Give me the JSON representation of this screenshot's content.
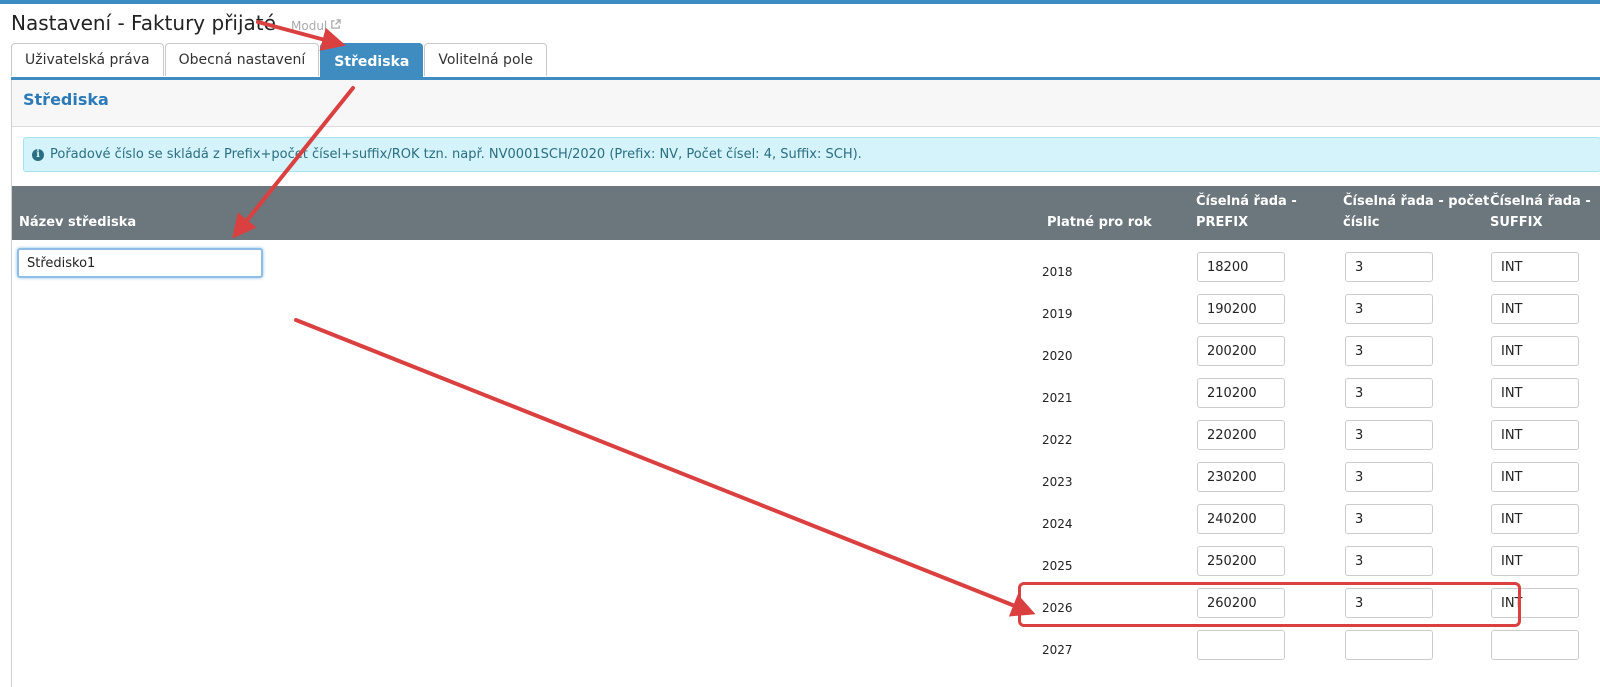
{
  "header": {
    "title": "Nastavení - Faktury přijaté",
    "modul_label": "Modul",
    "modul_icon": "external-link-icon"
  },
  "tabs": [
    {
      "label": "Uživatelská práva",
      "active": false
    },
    {
      "label": "Obecná nastavení",
      "active": false
    },
    {
      "label": "Střediska",
      "active": true
    },
    {
      "label": "Volitelná pole",
      "active": false
    }
  ],
  "panel": {
    "title": "Střediska",
    "info_text": "Pořadové číslo se skládá z Prefix+počet čísel+suffix/ROK tzn. např. NV0001SCH/2020 (Prefix: NV, Počet čísel: 4, Suffix: SCH)."
  },
  "table": {
    "headers": {
      "name": "Název střediska",
      "year": "Platné pro rok",
      "prefix": "Číselná řada - PREFIX",
      "pocet": "Číselná řada - počet číslic",
      "suffix": "Číselná řada - SUFFIX"
    },
    "name_value": "Středisko1",
    "rows": [
      {
        "year": "2018",
        "prefix": "18200",
        "pocet": "3",
        "suffix": "INT"
      },
      {
        "year": "2019",
        "prefix": "190200",
        "pocet": "3",
        "suffix": "INT"
      },
      {
        "year": "2020",
        "prefix": "200200",
        "pocet": "3",
        "suffix": "INT"
      },
      {
        "year": "2021",
        "prefix": "210200",
        "pocet": "3",
        "suffix": "INT"
      },
      {
        "year": "2022",
        "prefix": "220200",
        "pocet": "3",
        "suffix": "INT"
      },
      {
        "year": "2023",
        "prefix": "230200",
        "pocet": "3",
        "suffix": "INT"
      },
      {
        "year": "2024",
        "prefix": "240200",
        "pocet": "3",
        "suffix": "INT"
      },
      {
        "year": "2025",
        "prefix": "250200",
        "pocet": "3",
        "suffix": "INT"
      },
      {
        "year": "2026",
        "prefix": "260200",
        "pocet": "3",
        "suffix": "INT"
      },
      {
        "year": "2027",
        "prefix": "",
        "pocet": "",
        "suffix": ""
      }
    ]
  },
  "colors": {
    "accent": "#3e8cc0",
    "annotation": "#d9403f",
    "header_bg": "#6c767d",
    "alert_bg": "#d4f3fa"
  }
}
